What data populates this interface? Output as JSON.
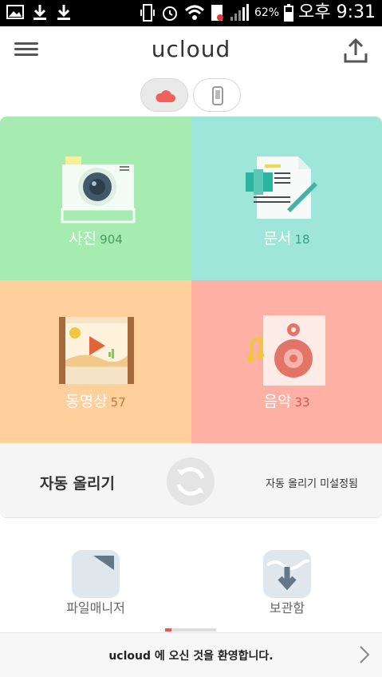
{
  "statusbar": {
    "left_icons": [
      "image-icon",
      "download-icon",
      "download-icon"
    ],
    "right_icons": [
      "vibrate-icon",
      "alarm-icon",
      "wifi-icon",
      "sim-icon",
      "signal-icon"
    ],
    "battery": "62%",
    "time": "오후 9:31"
  },
  "appbar": {
    "title": "ucloud"
  },
  "tiles": {
    "photo": {
      "name": "사진",
      "count": "904"
    },
    "docs": {
      "name": "문서",
      "count": "18"
    },
    "video": {
      "name": "동영상",
      "count": "57"
    },
    "music": {
      "name": "음악",
      "count": "33"
    }
  },
  "auto_upload": {
    "label": "자동 올리기",
    "status": "자동 올리기 미설정됨"
  },
  "bottom": {
    "file_manager": "파일매니저",
    "storage": "보관함"
  },
  "footer": {
    "text": "ucloud 에 오신 것을 환영합니다."
  },
  "colors": {
    "photo_bg": "#a6ebb0",
    "docs_bg": "#9fe6da",
    "video_bg": "#ffcf9c",
    "music_bg": "#ffb0a4",
    "accent": "#e65a4f"
  }
}
